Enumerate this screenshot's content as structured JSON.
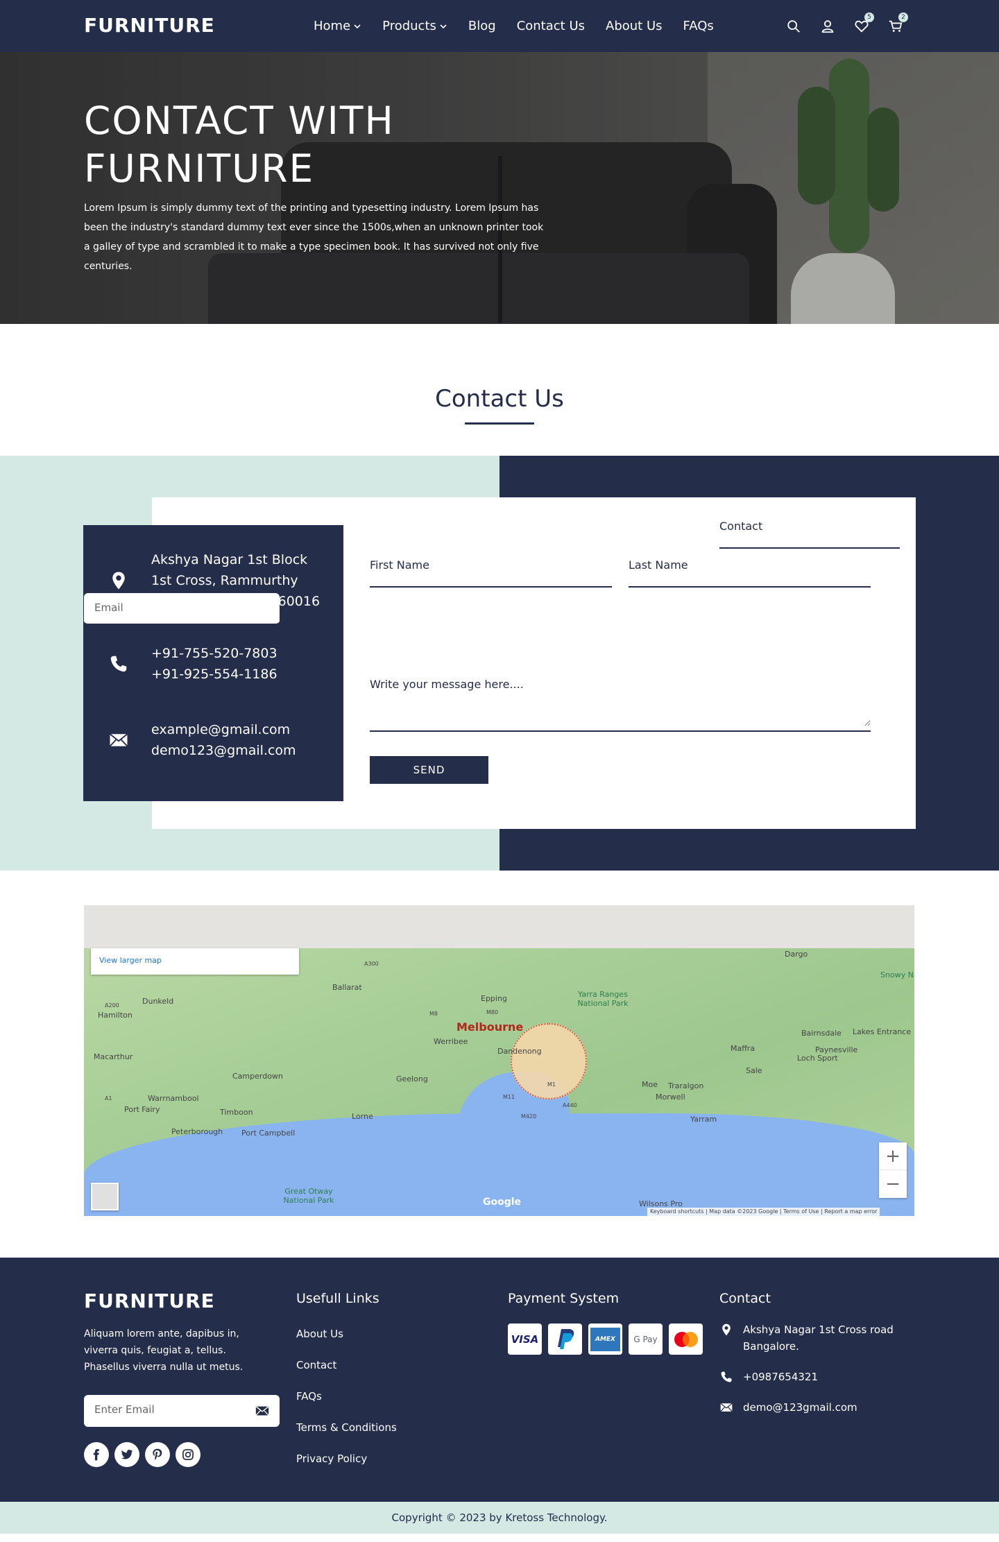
{
  "header": {
    "logo": "FURNITURE",
    "nav": [
      {
        "label": "Home",
        "dropdown": true
      },
      {
        "label": "Products",
        "dropdown": true
      },
      {
        "label": "Blog",
        "dropdown": false
      },
      {
        "label": "Contact Us",
        "dropdown": false
      },
      {
        "label": "About Us",
        "dropdown": false
      },
      {
        "label": "FAQs",
        "dropdown": false
      }
    ],
    "icons": [
      "search-icon",
      "user-icon",
      "heart-icon",
      "cart-icon"
    ],
    "wishlist_count": "5",
    "cart_count": "2"
  },
  "hero": {
    "title": "CONTACT WITH FURNITURE",
    "text": "Lorem Ipsum is simply dummy text of the printing and typesetting industry. Lorem Ipsum has been the industry's standard dummy text ever since the 1500s,when an unknown printer took a galley of type and scrambled it to make a type specimen book. It has survived not only five centuries."
  },
  "contact": {
    "title": "Contact Us",
    "address": [
      "Akshya Nagar 1st Block",
      "1st Cross, Rammurthy",
      "nagar, Bangalore-560016"
    ],
    "phones": [
      "+91-755-520-7803",
      "+91-925-554-1186"
    ],
    "emails": [
      "example@gmail.com",
      "demo123@gmail.com"
    ],
    "form": {
      "first_name_placeholder": "First Name",
      "last_name_placeholder": "Last Name",
      "email_placeholder": "Email",
      "contact_placeholder": "Contact",
      "message_placeholder": "Write your message here....",
      "send_label": "SEND"
    }
  },
  "map": {
    "view_larger": "View larger map",
    "city": "Melbourne",
    "places": [
      "Ballarat",
      "Dunkeld",
      "Hamilton",
      "Macarthur",
      "Warrnambool",
      "Port Fairy",
      "Timboon",
      "Peterborough",
      "Port Campbell",
      "Camperdown",
      "Geelong",
      "Werribee",
      "Dandenong",
      "Epping",
      "Lorne",
      "Maffra",
      "Sale",
      "Moe",
      "Traralgon",
      "Morwell",
      "Yarram",
      "Bairnsdale",
      "Lakes Entrance",
      "Paynesville",
      "Loch Sport",
      "Dargo",
      "Wilsons Pro"
    ],
    "parks": [
      "Yarra Ranges National Park",
      "Great Otway National Park",
      "Snowy Nationa"
    ],
    "roads": [
      "A300",
      "A200",
      "A1",
      "M1",
      "M8",
      "M80",
      "M11",
      "M420",
      "A440"
    ],
    "zoom_in": "+",
    "zoom_out": "−",
    "google": "Google",
    "footer_links": [
      "Keyboard shortcuts",
      "Map data ©2023 Google",
      "Terms of Use",
      "Report a map error"
    ]
  },
  "footer": {
    "logo": "FURNITURE",
    "about": "Aliquam lorem ante, dapibus in, viverra quis, feugiat a, tellus. Phasellus viverra nulla ut metus.",
    "email_placeholder": "Enter Email",
    "socials": [
      "facebook-icon",
      "twitter-icon",
      "pinterest-icon",
      "instagram-icon"
    ],
    "links_title": "Usefull Links",
    "links": [
      "About Us",
      "Contact",
      "FAQs",
      "Terms & Conditions",
      "Privacy Policy"
    ],
    "payment_title": "Payment System",
    "payments": [
      "VISA",
      "PayPal",
      "AMEX",
      "G Pay",
      "Mastercard"
    ],
    "contact_title": "Contact",
    "address": "Akshya Nagar 1st Cross road Bangalore.",
    "phone": "+0987654321",
    "email": "demo@123gmail.com",
    "copyright": "Copyright © 2023 by Kretoss Technology."
  },
  "colors": {
    "navy": "#242d4a",
    "mint": "#d4e8e4",
    "white": "#ffffff"
  }
}
